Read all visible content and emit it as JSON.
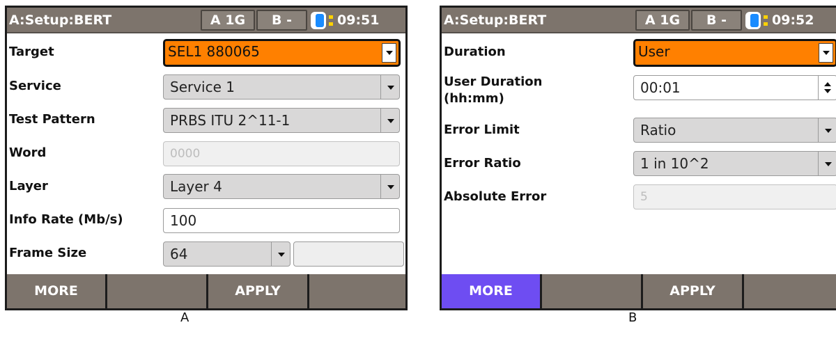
{
  "panel_a": {
    "title": "A:Setup:BERT",
    "port_a": "A 1G",
    "port_b": "B -",
    "clock": "09:51",
    "fields": {
      "target_label": "Target",
      "target_value": "SEL1 880065",
      "service_label": "Service",
      "service_value": "Service 1",
      "test_pattern_label": "Test Pattern",
      "test_pattern_value": "PRBS ITU 2^11-1",
      "word_label": "Word",
      "word_value": "0000",
      "layer_label": "Layer",
      "layer_value": "Layer 4",
      "info_rate_label": "Info Rate (Mb/s)",
      "info_rate_value": "100",
      "frame_size_label": "Frame Size",
      "frame_size_value": "64",
      "frame_size_extra": ""
    },
    "softkeys": {
      "more": "MORE",
      "key2": "",
      "apply": "APPLY",
      "key4": ""
    },
    "caption": "A"
  },
  "panel_b": {
    "title": "A:Setup:BERT",
    "port_a": "A 1G",
    "port_b": "B -",
    "clock": "09:52",
    "fields": {
      "duration_label": "Duration",
      "duration_value": "User",
      "user_duration_label_line1": "User Duration",
      "user_duration_label_line2": "(hh:mm)",
      "user_duration_value": "00:01",
      "error_limit_label": "Error Limit",
      "error_limit_value": "Ratio",
      "error_ratio_label": "Error Ratio",
      "error_ratio_value": "1 in 10^2",
      "absolute_error_label": "Absolute Error",
      "absolute_error_value": "5"
    },
    "softkeys": {
      "more": "MORE",
      "key2": "",
      "apply": "APPLY",
      "key4": ""
    },
    "caption": "B"
  },
  "colors": {
    "header_bar": "#7d746c",
    "active_field": "#ff8000",
    "highlight_softkey": "#6e4df2",
    "dropdown_bg": "#d9d8d8",
    "battery_blue": "#1a8cff",
    "battery_yellow": "#ffd200"
  },
  "icons": {
    "battery": "battery-status-icon",
    "dropdown": "chevron-down-icon",
    "spinner": "spinner-arrows-icon"
  }
}
